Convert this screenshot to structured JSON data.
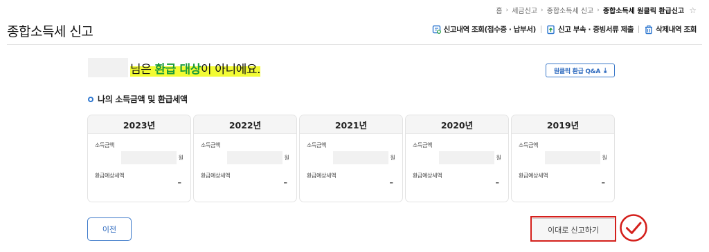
{
  "breadcrumb": {
    "items": [
      "홈",
      "세금신고",
      "종합소득세 신고",
      "종합소득세 원클릭 환급신고"
    ],
    "separator": "›"
  },
  "header": {
    "title": "종합소득세 신고",
    "links": [
      {
        "label": "신고내역 조회(접수증 · 납부서)",
        "icon": "document-search-icon"
      },
      {
        "label": "신고 부속 · 증빙서류 제출",
        "icon": "document-upload-icon"
      },
      {
        "label": "삭제내역 조회",
        "icon": "trash-icon"
      }
    ]
  },
  "notice": {
    "suffix_1": "님은 ",
    "highlight": "환급 대상",
    "suffix_2": "이 아니에요."
  },
  "qa_button": {
    "label": "원클릭 환급 Q&A"
  },
  "section": {
    "title": "나의 소득금액 및 환급세액"
  },
  "years": [
    {
      "year": "2023년",
      "income_label": "소득금액",
      "unit": "원",
      "refund_label": "환급예상세액",
      "refund_value": "–"
    },
    {
      "year": "2022년",
      "income_label": "소득금액",
      "unit": "원",
      "refund_label": "환급예상세액",
      "refund_value": "–"
    },
    {
      "year": "2021년",
      "income_label": "소득금액",
      "unit": "원",
      "refund_label": "환급예상세액",
      "refund_value": "–"
    },
    {
      "year": "2020년",
      "income_label": "소득금액",
      "unit": "원",
      "refund_label": "환급예상세액",
      "refund_value": "–"
    },
    {
      "year": "2019년",
      "income_label": "소득금액",
      "unit": "원",
      "refund_label": "환급예상세액",
      "refund_value": "–"
    }
  ],
  "buttons": {
    "prev": "이전",
    "submit": "이대로 신고하기"
  },
  "colors": {
    "accent_blue": "#2f6bbf",
    "highlight_green": "#1a9a39",
    "highlight_yellow": "#f2fb34",
    "annotation_red": "#d4201c"
  }
}
